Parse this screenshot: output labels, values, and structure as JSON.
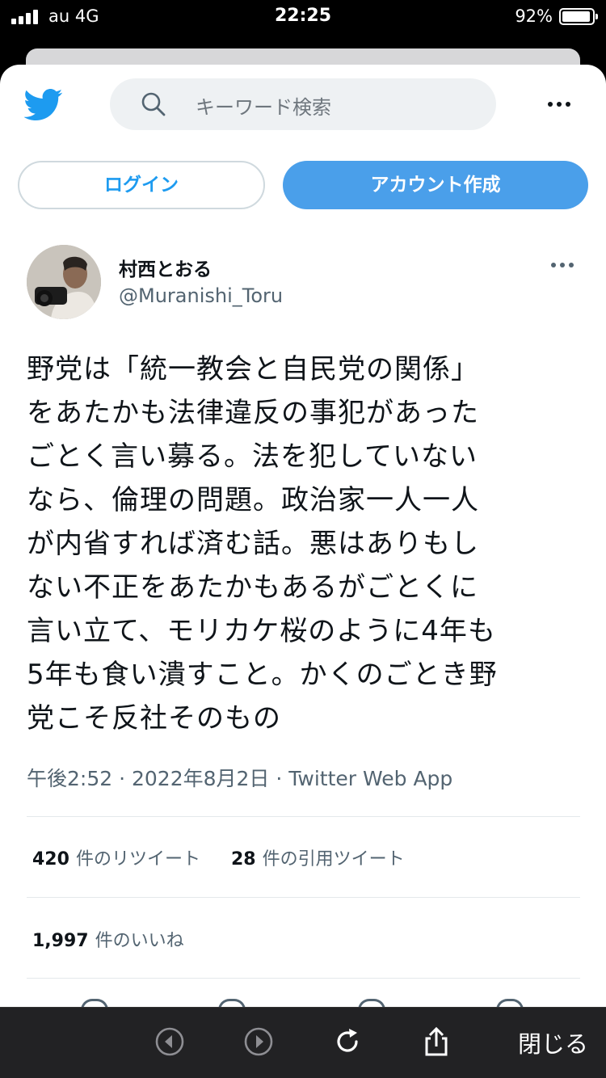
{
  "status_bar": {
    "carrier": "au  4G",
    "time": "22:25",
    "battery": "92%"
  },
  "header": {
    "logo_icon": "twitter-bird-icon",
    "search_placeholder": "キーワード検索",
    "more_icon": "more-horizontal-icon"
  },
  "auth": {
    "login_label": "ログイン",
    "signup_label": "アカウント作成"
  },
  "tweet": {
    "author_name": "村西とおる",
    "author_handle": "@Muranishi_Toru",
    "text": "野党は「統一教会と自民党の関係」\nをあたかも法律違反の事犯があった\nごとく言い募る。法を犯していない\nなら、倫理の問題。政治家一人一人\nが内省すれば済む話。悪はありもし\nない不正をあたかもあるがごとくに\n言い立て、モリカケ桜のように4年も\n5年も食い潰すこと。かくのごとき野\n党こそ反社そのもの",
    "meta": "午後2:52 · 2022年8月2日 · Twitter Web App",
    "retweets_count": "420",
    "retweets_label": "件のリツイート",
    "quotes_count": "28",
    "quotes_label": "件の引用ツイート",
    "likes_count": "1,997",
    "likes_label": "件のいいね"
  },
  "browser_toolbar": {
    "back_icon": "back-arrow-icon",
    "forward_icon": "forward-arrow-icon",
    "reload_icon": "reload-icon",
    "share_icon": "share-icon",
    "close_label": "閉じる"
  },
  "colors": {
    "accent": "#1d9bf0",
    "signup_button": "#4a9fea",
    "toolbar_bg": "#222224"
  }
}
